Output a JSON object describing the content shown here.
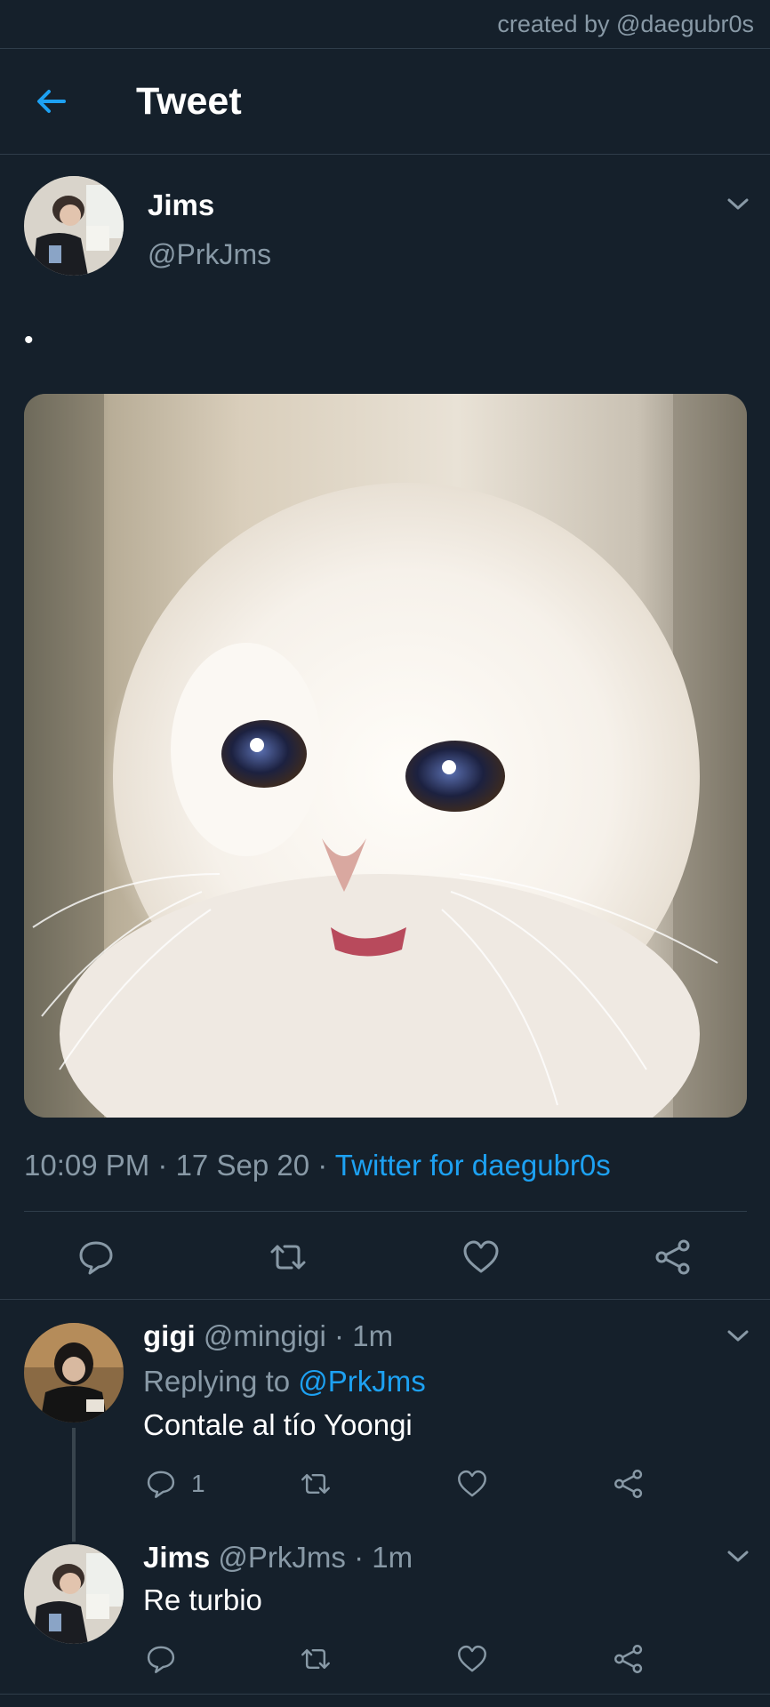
{
  "watermark": "created by @daegubr0s",
  "header": {
    "title": "Tweet",
    "back_icon": "arrow-left-icon",
    "accent": "#1da1f2"
  },
  "tweet": {
    "author_name": "Jims",
    "author_handle": "@PrkJms",
    "text": "•",
    "time": "10:09 PM",
    "sep1": " · ",
    "date": "17 Sep 20",
    "sep2": " · ",
    "source": "Twitter for daegubr0s",
    "actions": [
      "reply-icon",
      "retweet-icon",
      "like-icon",
      "share-icon"
    ]
  },
  "replies": [
    {
      "name": "gigi",
      "handle": "@mingigi",
      "dot": "·",
      "time": "1m",
      "replying_prefix": "Replying to",
      "replying_to": "@PrkJms",
      "text": "Contale al tío Yoongi",
      "reply_count": "1"
    },
    {
      "name": "Jims",
      "handle": "@PrkJms",
      "dot": "·",
      "time": "1m",
      "text": "Re turbio"
    }
  ],
  "colors": {
    "background": "#15202b",
    "secondary_text": "#8899a6",
    "link": "#1da1f2",
    "divider": "#2f3d4a"
  }
}
